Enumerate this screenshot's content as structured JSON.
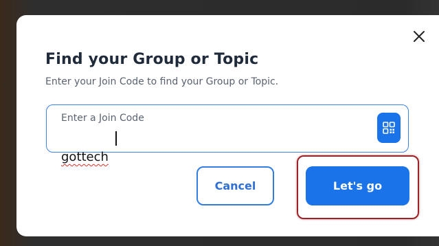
{
  "dialog": {
    "title": "Find your Group or Topic",
    "subtitle": "Enter your Join Code to find your Group or Topic.",
    "close_icon": "close-icon"
  },
  "join_code": {
    "label": "Enter a Join Code",
    "value": "gottech",
    "qr_icon": "qr-code-icon"
  },
  "actions": {
    "cancel_label": "Cancel",
    "go_label": "Let's go"
  },
  "colors": {
    "accent": "#1a73e8",
    "highlight": "#9b2226"
  }
}
